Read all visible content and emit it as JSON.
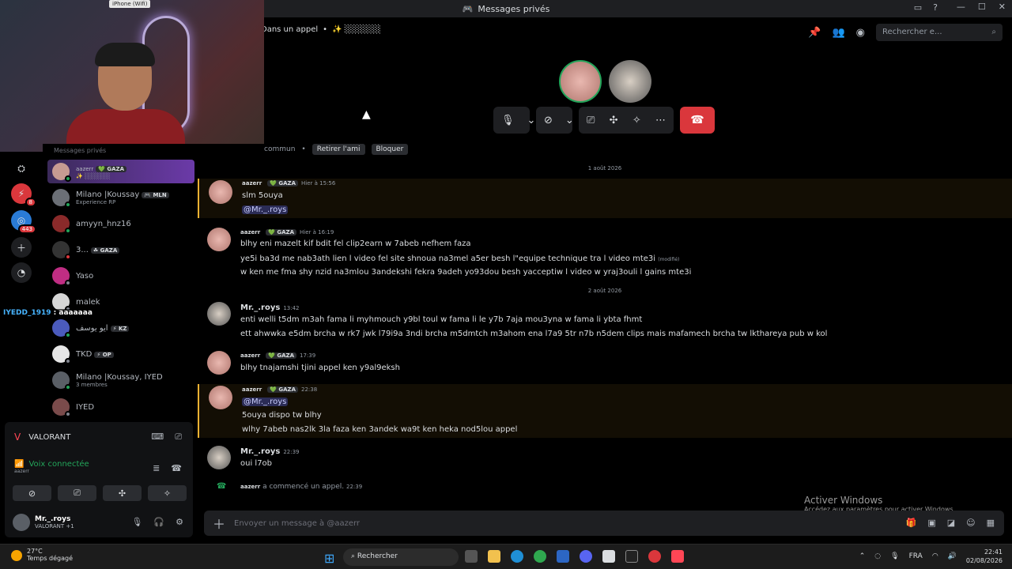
{
  "window": {
    "title": "Messages privés"
  },
  "webcam": {
    "label": "iPhone (Wifi)"
  },
  "call": {
    "dm_label": "Dans un appel",
    "dm_name": "✨ ░░░░░░",
    "search_placeholder": "Rechercher e..."
  },
  "rail": {
    "badge1": "8",
    "badge2": "443"
  },
  "dms": {
    "title": "Messages privés",
    "items": [
      {
        "name": "aazerr",
        "tag": "💚 GAZA",
        "sub": "✨ ░░░░░░",
        "color": "#c79b92"
      },
      {
        "name": "Milano |Koussay",
        "tag": "🎮 MLN",
        "sub": "Experience RP",
        "color": "#6b6f76"
      },
      {
        "name": "amyyn_hnz16",
        "tag": "",
        "sub": "",
        "color": "#8a2a2a"
      },
      {
        "name": "3...",
        "tag": "☘ GAZA",
        "sub": "",
        "color": "#333"
      },
      {
        "name": "Yaso",
        "tag": "",
        "sub": "",
        "color": "#c02d83"
      },
      {
        "name": "malek",
        "tag": "",
        "sub": "",
        "color": "#d6d6d6"
      },
      {
        "name": "ايو يوسف",
        "tag": "⚡ KZ",
        "sub": "",
        "color": "#4b5bbd"
      },
      {
        "name": "TKD",
        "tag": "⚡ OP",
        "sub": "",
        "color": "#e6e6e6"
      },
      {
        "name": "Milano |Koussay, IYED",
        "tag": "",
        "sub": "3 membres",
        "color": "#5a5f66"
      },
      {
        "name": "IYED",
        "tag": "",
        "sub": "",
        "color": "#7a4b4b"
      }
    ]
  },
  "overlay": {
    "user": "IYEDD_1919",
    "text": ": aaaaaaa"
  },
  "userpanel": {
    "game": "VALORANT",
    "voice": "Voix connectée",
    "voice_sub": "aazerr",
    "username": "Mr._.roys",
    "status": "VALORANT +1"
  },
  "chat": {
    "common": "commun",
    "remove_friend": "Retirer l'ami",
    "block": "Bloquer",
    "date1": "1 août 2026",
    "date2": "2 août 2026",
    "messages": [
      {
        "author": "aazerr",
        "tag": "💚 GAZA",
        "time": "Hier à 15:56",
        "lines": [
          "slm 5ouya"
        ],
        "mention": "@Mr._.roys"
      },
      {
        "author": "aazerr",
        "tag": "💚 GAZA",
        "time": "Hier à 16:19",
        "lines": [
          "blhy eni mazelt kif bdit fel clip2earn w 7abeb nefhem faza",
          "ye5i ba3d me nab3ath lien l video fel site shnoua na3mel a5er besh l\"equipe technique tra l video mte3i",
          "w ken me fma shy nzid na3mlou 3andekshi fekra 9adeh yo93dou besh yacceptiw l video w yraj3ouli l gains mte3i"
        ],
        "edited": "(modifié)"
      },
      {
        "author": "Mr._.roys",
        "time": "13:42",
        "lines": [
          "enti welli t5dm m3ah fama li myhmouch y9bl toul w fama li le y7b 7aja mou3yna w fama li ybta fhmt",
          "ett ahwwka e5dm brcha w rk7 jwk l79i9a 3ndi brcha m5dmtch m3ahom ena l7a9 5tr n7b n5dem clips mais mafamech brcha tw lkthareya pub w kol"
        ]
      },
      {
        "author": "aazerr",
        "tag": "💚 GAZA",
        "time": "17:39",
        "lines": [
          "blhy tnajamshi tjini appel ken y9al9eksh"
        ]
      },
      {
        "author": "aazerr",
        "tag": "💚 GAZA",
        "time": "22:38",
        "mention": "@Mr._.roys",
        "lines": [
          "5ouya dispo tw blhy",
          "wlhy 7abeb nas2lk 3la faza ken 3andek wa9t ken heka nod5lou appel"
        ]
      },
      {
        "author": "Mr._.roys",
        "time": "22:39",
        "lines": [
          "oui l7ob"
        ]
      }
    ],
    "call_notice_user": "aazerr",
    "call_notice": "a commencé un appel.",
    "call_notice_time": "22:39",
    "composer_placeholder": "Envoyer un message à @aazerr"
  },
  "activation": {
    "title": "Activer Windows",
    "sub": "Accédez aux paramètres pour activer Windows."
  },
  "taskbar": {
    "temp": "27°C",
    "weather": "Temps dégagé",
    "search": "Rechercher",
    "lang": "FRA",
    "time": "22:41",
    "date": "02/08/2026"
  },
  "colors": {
    "accent": "#5865f2",
    "danger": "#da373c",
    "online": "#23a55a"
  }
}
